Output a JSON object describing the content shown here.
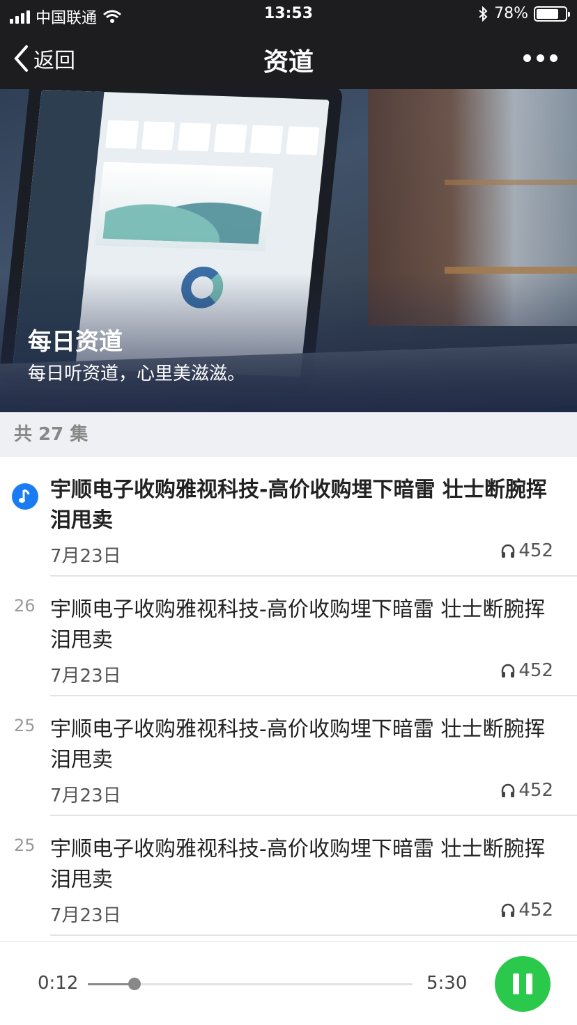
{
  "status_bar": {
    "carrier": "中国联通",
    "time": "13:53",
    "battery_percent": "78%",
    "battery_level": 0.78
  },
  "nav": {
    "back_label": "返回",
    "title": "资道"
  },
  "hero": {
    "title": "每日资道",
    "subtitle": "每日听资道，心里美滋滋。"
  },
  "episode_count_label": "共 27 集",
  "episodes": [
    {
      "number": "",
      "title": "宇顺电子收购雅视科技-高价收购埋下暗雷 壮士断腕挥泪甩卖",
      "date": "7月23日",
      "plays": "452",
      "active": true
    },
    {
      "number": "26",
      "title": "宇顺电子收购雅视科技-高价收购埋下暗雷 壮士断腕挥泪甩卖",
      "date": "7月23日",
      "plays": "452",
      "active": false
    },
    {
      "number": "25",
      "title": "宇顺电子收购雅视科技-高价收购埋下暗雷 壮士断腕挥泪甩卖",
      "date": "7月23日",
      "plays": "452",
      "active": false
    },
    {
      "number": "25",
      "title": "宇顺电子收购雅视科技-高价收购埋下暗雷 壮士断腕挥泪甩卖",
      "date": "7月23日",
      "plays": "452",
      "active": false
    }
  ],
  "player": {
    "current_time": "0:12",
    "total_time": "5:30",
    "progress": 0.143
  },
  "colors": {
    "accent_blue": "#1a7cf2",
    "play_green": "#2ac94b",
    "nav_bg": "#1d1d1f"
  }
}
